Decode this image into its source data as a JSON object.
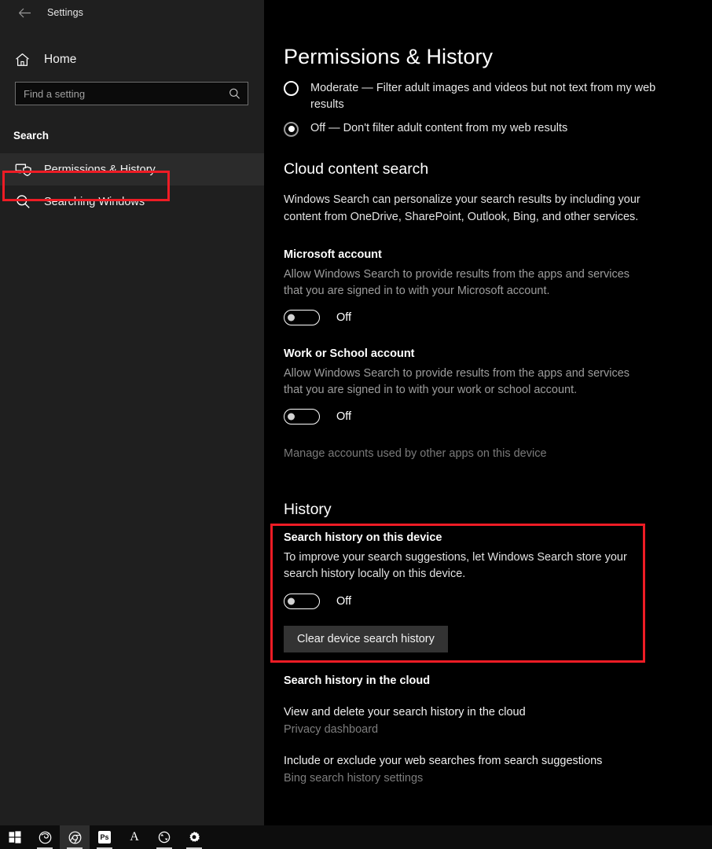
{
  "window": {
    "back_icon": "back-arrow-icon",
    "title": "Settings"
  },
  "sidebar": {
    "home": {
      "icon": "home-icon",
      "label": "Home"
    },
    "search": {
      "placeholder": "Find a setting",
      "value": "",
      "icon": "search-icon"
    },
    "group_title": "Search",
    "items": [
      {
        "label": "Permissions & History",
        "icon": "permissions-shield-icon",
        "selected": true
      },
      {
        "label": "Searching Windows",
        "icon": "search-icon",
        "selected": false
      }
    ]
  },
  "main": {
    "page_title": "Permissions & History",
    "safe_search": {
      "options": [
        {
          "label": "Moderate — Filter adult images and videos but not text from my web results",
          "checked": false
        },
        {
          "label": "Off — Don't filter adult content from my web results",
          "checked": true
        }
      ]
    },
    "cloud_content": {
      "heading": "Cloud content search",
      "description": "Windows Search can personalize your search results by including your content from OneDrive, SharePoint, Outlook, Bing, and other services.",
      "microsoft_account": {
        "title": "Microsoft account",
        "description": "Allow Windows Search to provide results from the apps and services that you are signed in to with your Microsoft account.",
        "toggle_state": "Off"
      },
      "work_school_account": {
        "title": "Work or School account",
        "description": "Allow Windows Search to provide results from the apps and services that you are signed in to with your work or school account.",
        "toggle_state": "Off"
      },
      "manage_link": "Manage accounts used by other apps on this device"
    },
    "history": {
      "heading": "History",
      "device": {
        "title": "Search history on this device",
        "description": "To improve your search suggestions, let Windows Search store your search history locally on this device.",
        "toggle_state": "Off",
        "clear_button": "Clear device search history"
      },
      "cloud": {
        "title": "Search history in the cloud",
        "links": [
          {
            "label": "View and delete your search history in the cloud",
            "sub": "Privacy dashboard"
          },
          {
            "label": "Include or exclude your web searches from search suggestions",
            "sub": "Bing search history settings"
          }
        ]
      }
    }
  },
  "annotations": {
    "color": "#ee1c25",
    "targets": [
      "sidebar-item-permissions-history",
      "search-history-on-this-device-card"
    ]
  },
  "taskbar": {
    "items": [
      {
        "icon": "windows-start-icon",
        "glyph": "start",
        "active": false,
        "running": false
      },
      {
        "icon": "firefox-icon",
        "glyph": "firefox",
        "active": false,
        "running": true
      },
      {
        "icon": "chrome-icon",
        "glyph": "chrome",
        "active": true,
        "running": true
      },
      {
        "icon": "photoshop-icon",
        "glyph": "Ps",
        "active": false,
        "running": true
      },
      {
        "icon": "font-letter-a-icon",
        "glyph": "A",
        "active": false,
        "running": false
      },
      {
        "icon": "sync-refresh-icon",
        "glyph": "sync",
        "active": false,
        "running": true
      },
      {
        "icon": "gear-settings-icon",
        "glyph": "gear",
        "active": false,
        "running": true
      }
    ]
  }
}
